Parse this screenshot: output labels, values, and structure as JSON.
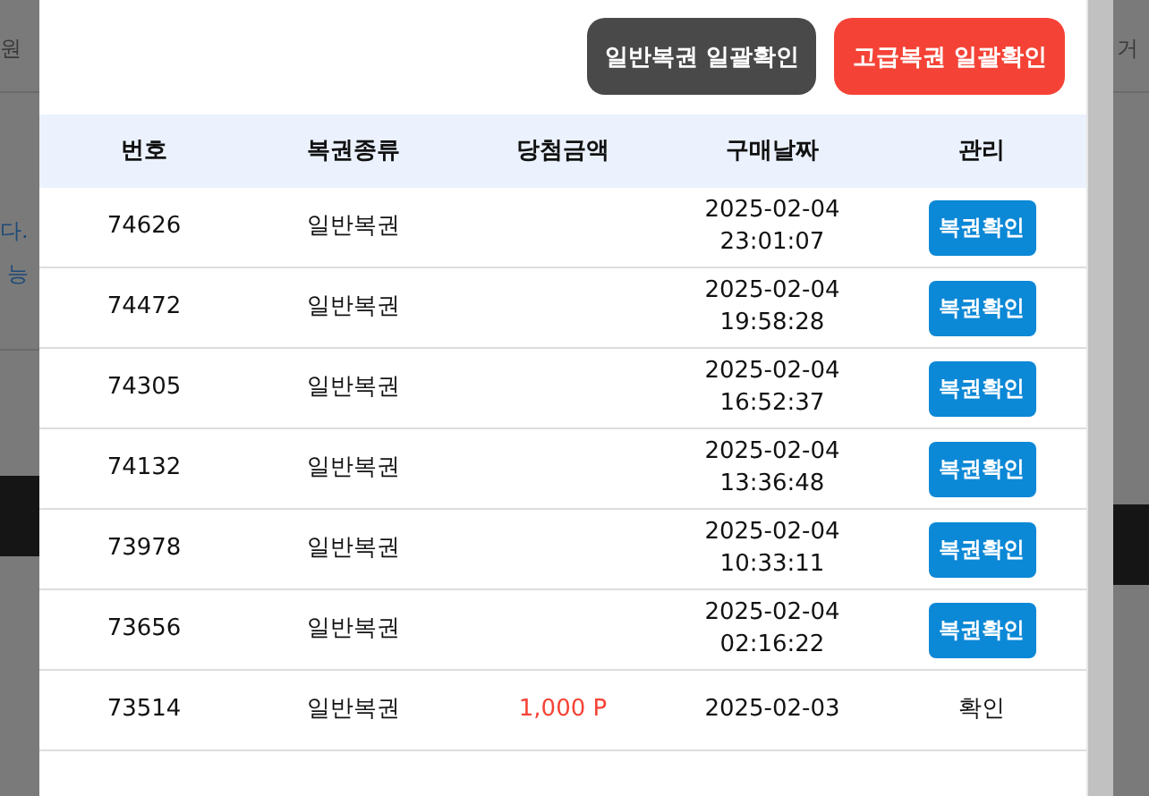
{
  "backdrop": {
    "left_texts": [
      "원",
      "다.",
      "능"
    ],
    "right_texts": [
      "거"
    ]
  },
  "actions": [
    {
      "label": "일반복권 일괄확인",
      "kind": "dark"
    },
    {
      "label": "고급복권 일괄확인",
      "kind": "red"
    }
  ],
  "table": {
    "columns": [
      "번호",
      "복권종류",
      "당첨금액",
      "구매날짜",
      "관리"
    ],
    "rows": [
      {
        "number": "74626",
        "type": "일반복권",
        "date": "2025-02-04",
        "time": "23:01:07",
        "manage": {
          "kind": "button",
          "label": "복권확인"
        }
      },
      {
        "number": "74472",
        "type": "일반복권",
        "date": "2025-02-04",
        "time": "19:58:28",
        "manage": {
          "kind": "button",
          "label": "복권확인"
        }
      },
      {
        "number": "74305",
        "type": "일반복권",
        "date": "2025-02-04",
        "time": "16:52:37",
        "manage": {
          "kind": "button",
          "label": "복권확인"
        }
      },
      {
        "number": "74132",
        "type": "일반복권",
        "date": "2025-02-04",
        "time": "13:36:48",
        "manage": {
          "kind": "button",
          "label": "복권확인"
        }
      },
      {
        "number": "73978",
        "type": "일반복권",
        "date": "2025-02-04",
        "time": "10:33:11",
        "manage": {
          "kind": "button",
          "label": "복권확인"
        }
      },
      {
        "number": "73656",
        "type": "일반복권",
        "date": "2025-02-04",
        "time": "02:16:22",
        "manage": {
          "kind": "button",
          "label": "복권확인"
        }
      },
      {
        "number": "73514",
        "type": "일반복권",
        "amount": "1,000 P",
        "date": "2025-02-03",
        "manage": {
          "kind": "text",
          "label": "확인"
        }
      }
    ]
  }
}
